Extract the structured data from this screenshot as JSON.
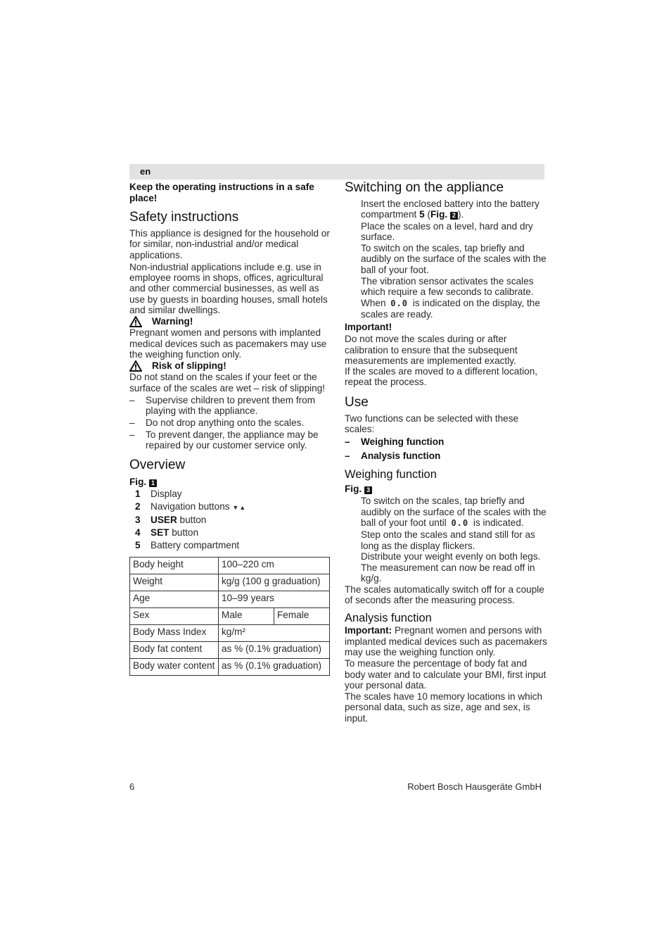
{
  "header": {
    "language": "en"
  },
  "left": {
    "keep_note": "Keep the operating instructions in a safe place!",
    "safety": {
      "title": "Safety instructions",
      "para1": "This appliance is designed for the household or for similar, non-industrial and/or medical applications.",
      "para2": "Non-industrial applications include e.g. use in employee rooms in shops, offices, agricultural and other commercial businesses, as well as use by guests in boarding houses, small hotels and similar dwellings.",
      "warning_label": "Warning!",
      "warning_text": "Pregnant women and persons with implanted medical devices such as pacemakers may use the weighing function only.",
      "slip_label": "Risk of slipping!",
      "slip_text": "Do not stand on the scales if your feet or the surface of the scales are wet – risk of slipping!",
      "bullets": [
        "Supervise children to prevent them from playing with the appliance.",
        "Do not drop anything onto the scales.",
        "To prevent danger, the appliance may be repaired by our customer service only."
      ],
      "warning_icon": "warning-triangle-icon"
    },
    "overview": {
      "title": "Overview",
      "fig_label": "Fig.",
      "fig_number": "1",
      "items": [
        {
          "num": "1",
          "bold": "",
          "text": "Display"
        },
        {
          "num": "2",
          "bold": "",
          "text": "Navigation buttons",
          "arrows": "▼▲"
        },
        {
          "num": "3",
          "bold": "USER",
          "text": " button"
        },
        {
          "num": "4",
          "bold": "SET",
          "text": " button"
        },
        {
          "num": "5",
          "bold": "",
          "text": "Battery compartment"
        }
      ]
    },
    "spec_table": {
      "rows": [
        {
          "label": "Body height",
          "value": "100–220 cm"
        },
        {
          "label": "Weight",
          "value": "kg/g (100 g graduation)"
        },
        {
          "label": "Age",
          "value": "10–99 years"
        },
        {
          "label": "Sex",
          "value": "Male",
          "value2": "Female"
        },
        {
          "label": "Body Mass Index",
          "value": "kg/m²"
        },
        {
          "label": "Body fat content",
          "value": "as % (0.1% graduation)"
        },
        {
          "label": "Body water content",
          "value": "as % (0.1% graduation)"
        }
      ]
    }
  },
  "right": {
    "switching": {
      "title": "Switching on the appliance",
      "step1_a": "Insert the enclosed battery into the battery compartment ",
      "step1_num": "5",
      "step1_fig": "Fig.",
      "step1_fig_number": "2",
      "step2": "Place the scales on a level, hard and dry surface.",
      "step3": "To switch on the scales, tap briefly and audibly on the surface of the scales with the ball of your foot.",
      "step4_a": "The vibration sensor activates the scales which require a few seconds to calibrate. When",
      "display_reading": "0.0",
      "step4_b": "is indicated on the display, the scales are ready.",
      "important_label": "Important!",
      "important_text1": "Do not move the scales during or after calibration to ensure that the subsequent measurements are implemented exactly.",
      "important_text2": "If the scales are moved to a different location, repeat the process."
    },
    "use": {
      "title": "Use",
      "intro": "Two functions can be selected with these scales:",
      "functions": [
        "Weighing function",
        "Analysis function"
      ]
    },
    "weighing": {
      "title": "Weighing function",
      "fig_label": "Fig.",
      "fig_number": "3",
      "step1_a": "To switch on the scales, tap briefly and audibly on the surface of the scales with the ball of your foot until",
      "display_reading": "0.0",
      "step1_b": "is indicated.",
      "step2": "Step onto the scales and stand still for as long as the display flickers.",
      "step3": "Distribute your weight evenly on both legs.",
      "step4": "The measurement can now be read off in kg/g.",
      "auto_off": "The scales automatically switch off for a couple of seconds after the measuring process."
    },
    "analysis": {
      "title": "Analysis function",
      "important_label": "Important:",
      "important_text": " Pregnant women and persons with implanted medical devices such as pacemakers may use the weighing function only.",
      "para1": "To measure the percentage of body fat and body water and to calculate your BMI, first input your personal data.",
      "para2": "The scales have 10 memory locations in which personal data, such as size, age and  sex, is input."
    }
  },
  "footer": {
    "page_number": "6",
    "company": "Robert Bosch Hausgeräte GmbH"
  }
}
